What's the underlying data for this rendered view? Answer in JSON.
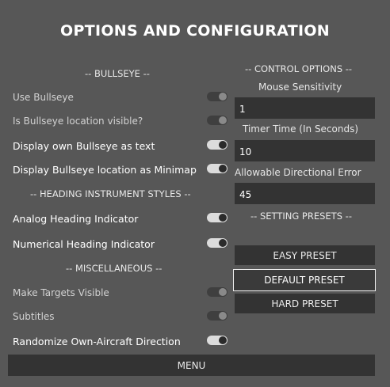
{
  "title": "OPTIONS AND CONFIGURATION",
  "sections": {
    "bullseye": "-- BULLSEYE --",
    "heading": "-- HEADING INSTRUMENT STYLES --",
    "misc": "-- MISCELLANEOUS --",
    "control": "-- CONTROL OPTIONS --",
    "presets": "-- SETTING PRESETS --"
  },
  "toggles": {
    "use_bullseye": {
      "label": "Use Bullseye",
      "on": false
    },
    "bullseye_visible": {
      "label": "Is Bullseye location visible?",
      "on": false
    },
    "bullseye_text": {
      "label": "Display own Bullseye as text",
      "on": true
    },
    "bullseye_minimap": {
      "label": "Display Bullseye location as Minimap",
      "on": true
    },
    "analog_heading": {
      "label": "Analog Heading Indicator",
      "on": true
    },
    "numerical_heading": {
      "label": "Numerical Heading Indicator",
      "on": true
    },
    "targets_visible": {
      "label": "Make Targets Visible",
      "on": false
    },
    "subtitles": {
      "label": "Subtitles",
      "on": false
    },
    "randomize_direction": {
      "label": "Randomize Own-Aircraft Direction",
      "on": true
    }
  },
  "controls": {
    "mouse_sensitivity": {
      "label": "Mouse Sensitivity",
      "value": "1"
    },
    "timer_time": {
      "label": "Timer Time (In Seconds)",
      "value": "10"
    },
    "directional_error": {
      "label": "Allowable Directional Error",
      "value": "45"
    }
  },
  "presets": {
    "easy": "EASY PRESET",
    "default": "DEFAULT PRESET",
    "hard": "HARD PRESET",
    "selected": "default"
  },
  "menu_label": "MENU"
}
